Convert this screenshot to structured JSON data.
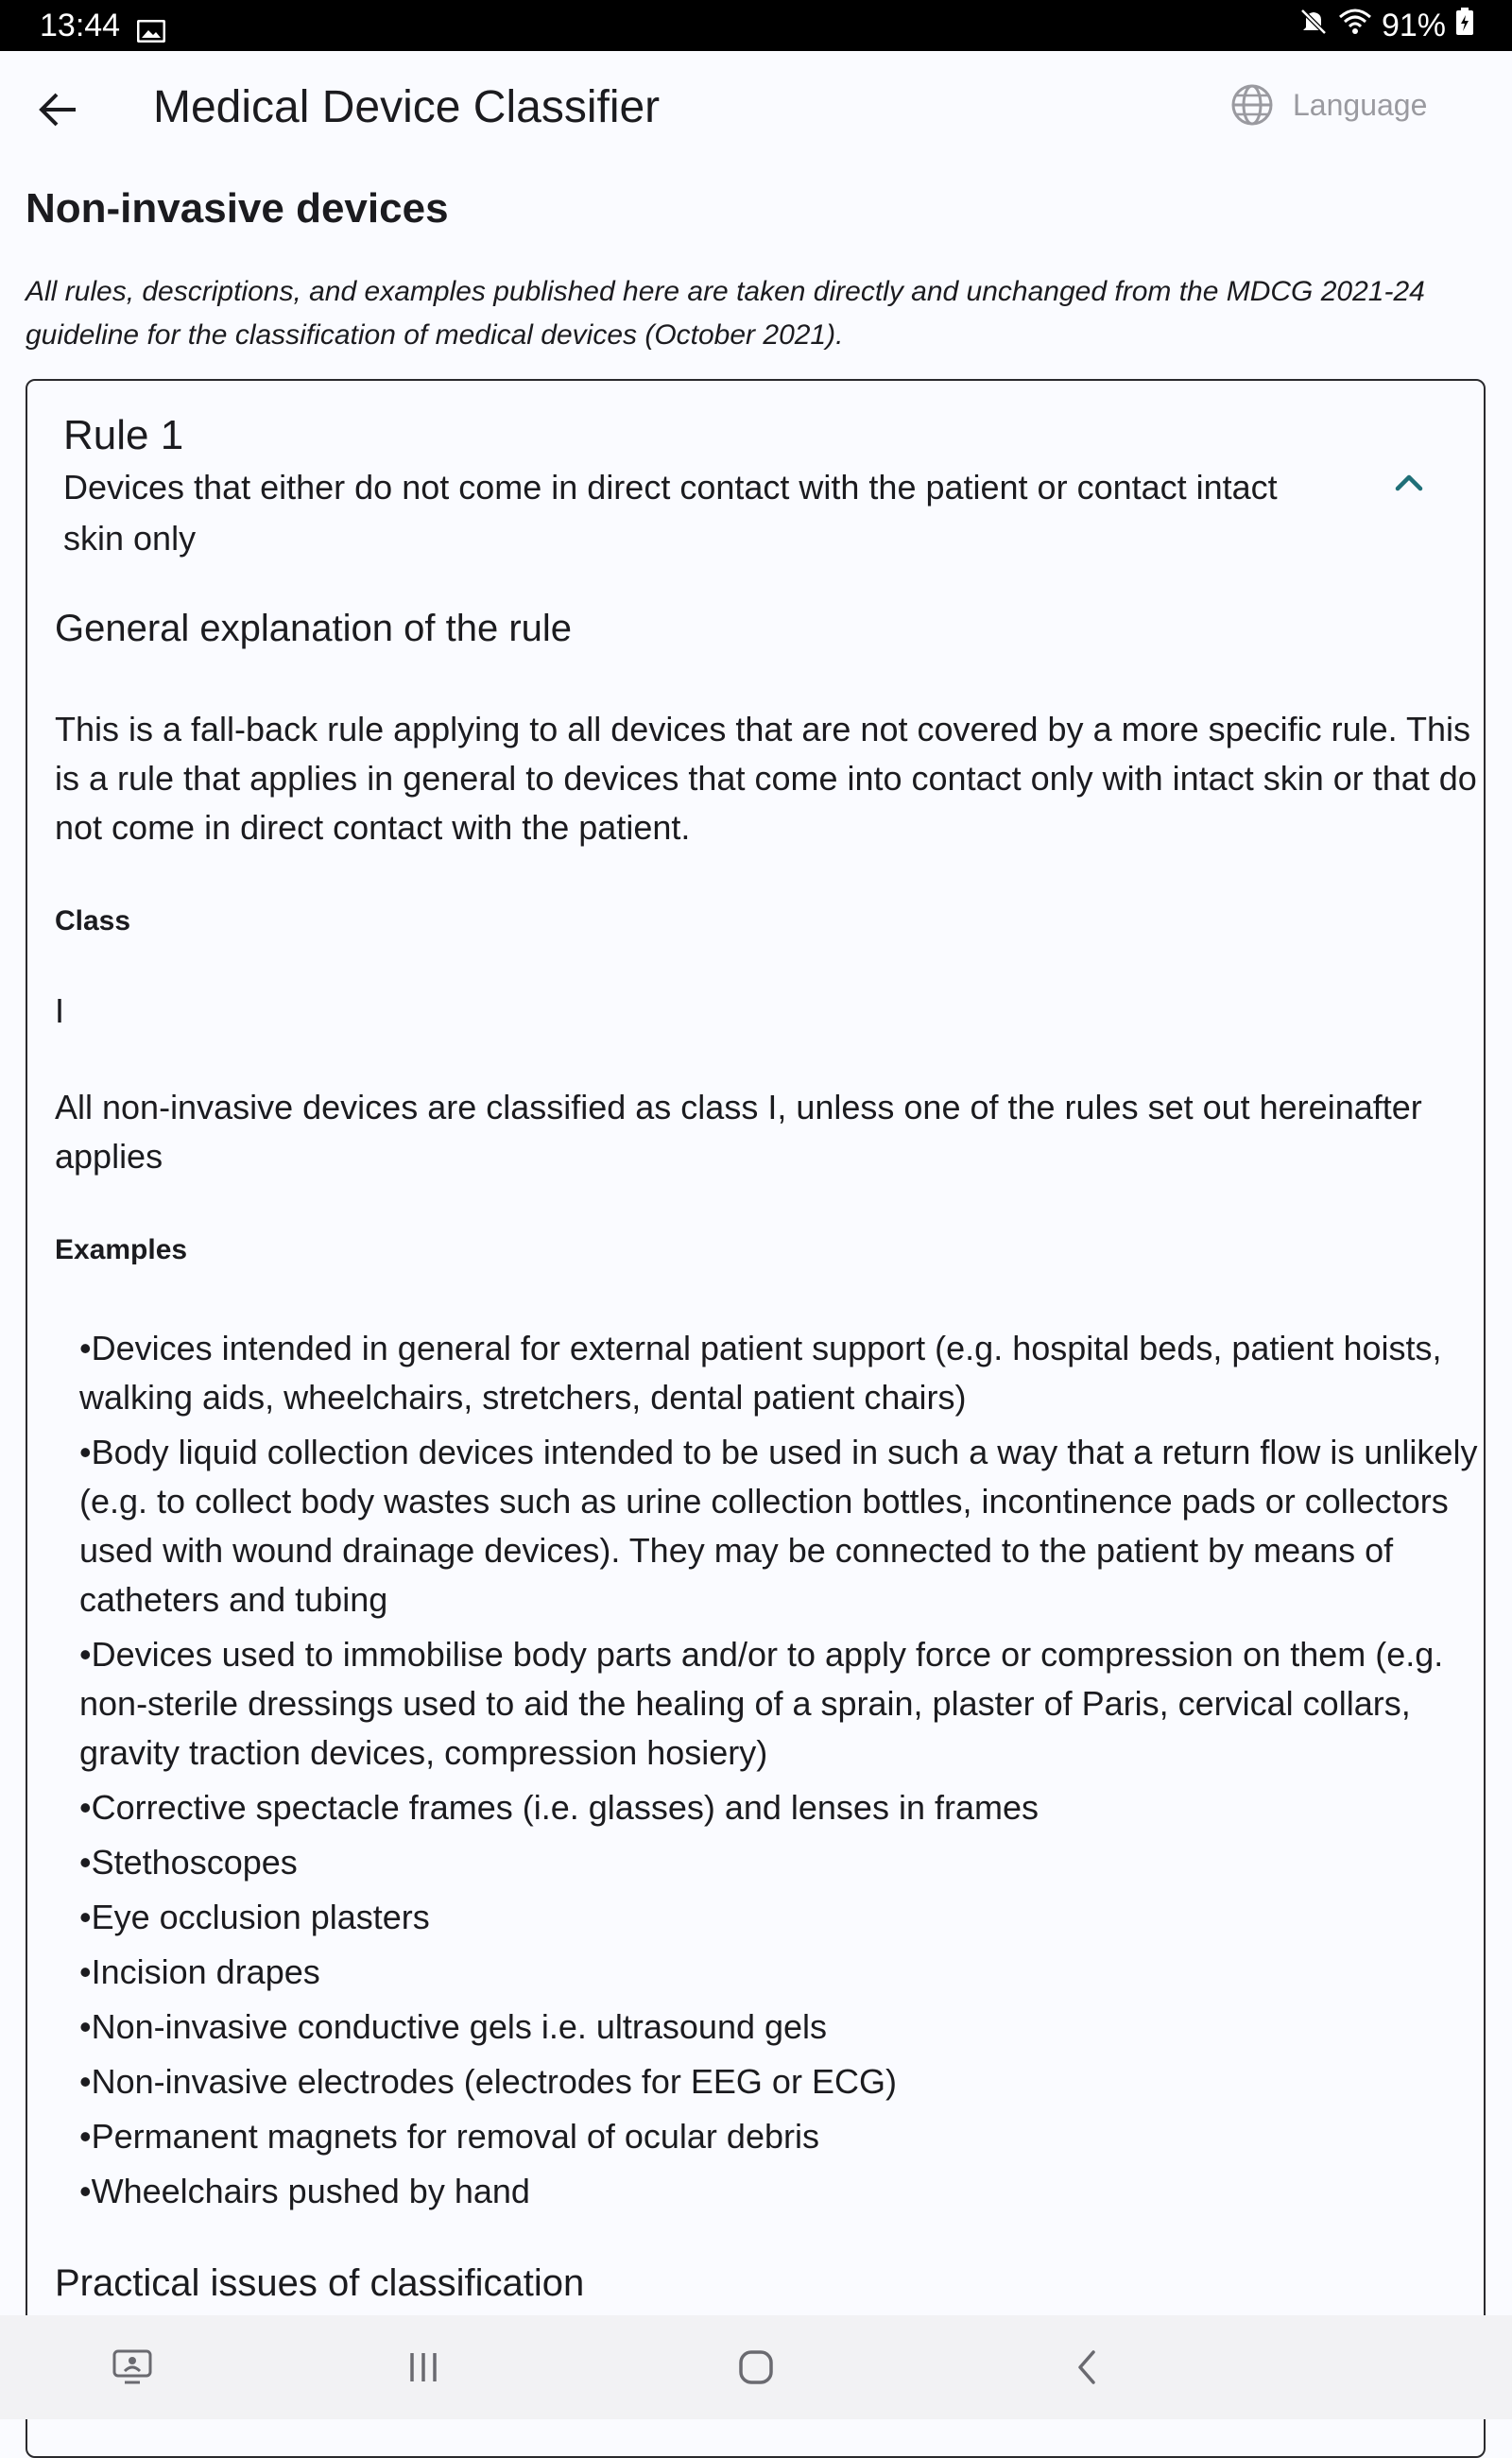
{
  "status": {
    "time": "13:44",
    "battery": "91%"
  },
  "appbar": {
    "title": "Medical Device Classifier",
    "language_label": "Language"
  },
  "page": {
    "section_title": "Non-invasive devices",
    "disclaimer": "All rules, descriptions, and examples published here are taken directly and unchanged from the MDCG 2021-24 guideline for the classification of medical devices (October 2021)."
  },
  "rule": {
    "title": "Rule 1",
    "subtitle": "Devices that either do not come in direct contact with the patient or contact intact skin only",
    "general_heading": "General explanation of the rule",
    "general_text": "This is a fall-back rule applying to all devices that are not covered by a more specific rule. This is a rule that applies in general to devices that come into contact only with intact skin or that do not come in direct contact with the patient.",
    "class_label": "Class",
    "class_value": "I",
    "class_text": "All non-invasive devices are classified as class I, unless one of the rules set out hereinafter applies",
    "examples_label": "Examples",
    "examples": [
      "Devices intended in general for external patient support (e.g. hospital beds, patient hoists, walking aids, wheelchairs, stretchers, dental patient chairs)",
      "Body liquid collection devices intended to be used in such a way that a return flow is unlikely (e.g. to collect body wastes such as urine collection bottles, incontinence pads or collectors used with wound drainage devices). They may be connected to the patient by means of catheters and tubing",
      "Devices used to immobilise body parts and/or to apply force or compression on them (e.g. non-sterile dressings used to aid the healing of a sprain, plaster of Paris, cervical collars, gravity traction devices, compression hosiery)",
      "Corrective spectacle frames (i.e. glasses) and lenses in frames",
      "Stethoscopes",
      "Eye occlusion plasters",
      "Incision drapes",
      "Non-invasive conductive gels i.e. ultrasound gels",
      "Non-invasive electrodes (electrodes for EEG or ECG)",
      "Permanent magnets for removal of ocular debris",
      "Wheelchairs pushed by hand"
    ],
    "next_heading": "Practical issues of classification"
  },
  "colors": {
    "accent": "#1f6f78",
    "statusbar": "#000000",
    "navbar": "#f2f2f4"
  }
}
